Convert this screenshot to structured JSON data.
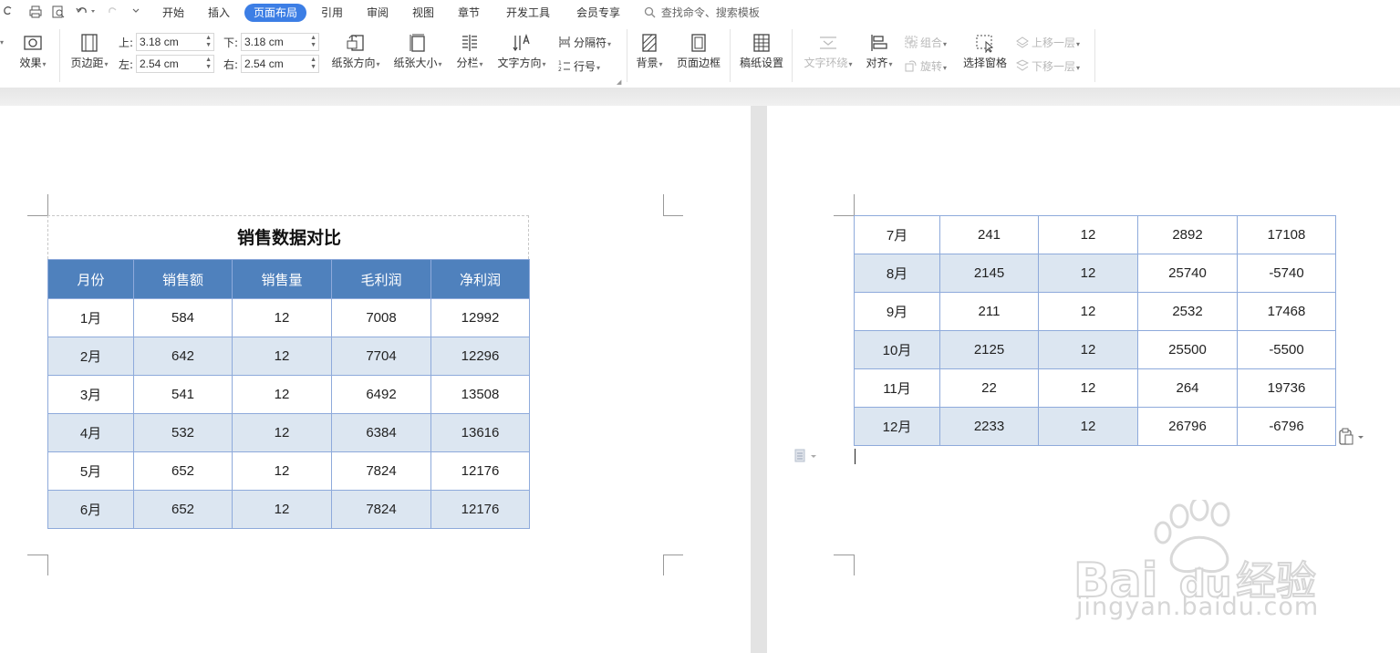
{
  "quick_access": [
    "undo-redo",
    "print",
    "print-preview",
    "undo",
    "redo",
    "customize"
  ],
  "tabs": [
    {
      "label": "开始"
    },
    {
      "label": "插入"
    },
    {
      "label": "页面布局",
      "active": true
    },
    {
      "label": "引用"
    },
    {
      "label": "审阅"
    },
    {
      "label": "视图"
    },
    {
      "label": "章节"
    },
    {
      "label": "开发工具"
    },
    {
      "label": "会员专享"
    }
  ],
  "search": {
    "placeholder": "查找命令、搜索模板"
  },
  "ribbon": {
    "effects": "效果",
    "margins": "页边距",
    "margin_top_label": "上:",
    "margin_top_value": "3.18 cm",
    "margin_bottom_label": "下:",
    "margin_bottom_value": "3.18 cm",
    "margin_left_label": "左:",
    "margin_left_value": "2.54 cm",
    "margin_right_label": "右:",
    "margin_right_value": "2.54 cm",
    "orientation": "纸张方向",
    "paper_size": "纸张大小",
    "columns": "分栏",
    "text_direction": "文字方向",
    "breaks": "分隔符",
    "line_numbers": "行号",
    "background": "背景",
    "page_border": "页面边框",
    "manuscript": "稿纸设置",
    "text_wrap": "文字环绕",
    "align": "对齐",
    "group": "组合",
    "rotate": "旋转",
    "selection_pane": "选择窗格",
    "bring_forward": "上移一层",
    "send_backward": "下移一层"
  },
  "document": {
    "title": "销售数据对比",
    "headers": [
      "月份",
      "销售额",
      "销售量",
      "毛利润",
      "净利润"
    ],
    "page1_rows": [
      [
        "1月",
        "584",
        "12",
        "7008",
        "12992"
      ],
      [
        "2月",
        "642",
        "12",
        "7704",
        "12296"
      ],
      [
        "3月",
        "541",
        "12",
        "6492",
        "13508"
      ],
      [
        "4月",
        "532",
        "12",
        "6384",
        "13616"
      ],
      [
        "5月",
        "652",
        "12",
        "7824",
        "12176"
      ],
      [
        "6月",
        "652",
        "12",
        "7824",
        "12176"
      ]
    ],
    "page2_rows": [
      [
        "7月",
        "241",
        "12",
        "2892",
        "17108"
      ],
      [
        "8月",
        "2145",
        "12",
        "25740",
        "-5740"
      ],
      [
        "9月",
        "211",
        "12",
        "2532",
        "17468"
      ],
      [
        "10月",
        "2125",
        "12",
        "25500",
        "-5500"
      ],
      [
        "11月",
        "22",
        "12",
        "264",
        "19736"
      ],
      [
        "12月",
        "2233",
        "12",
        "26796",
        "-6796"
      ]
    ]
  },
  "watermark": {
    "brand": "Baidu经验",
    "url": "jingyan.baidu.com"
  },
  "colors": {
    "header_fill": "#4f81bd",
    "band_fill": "#dce6f1",
    "border": "#8eaadb",
    "active_tab": "#3c7ee5"
  }
}
